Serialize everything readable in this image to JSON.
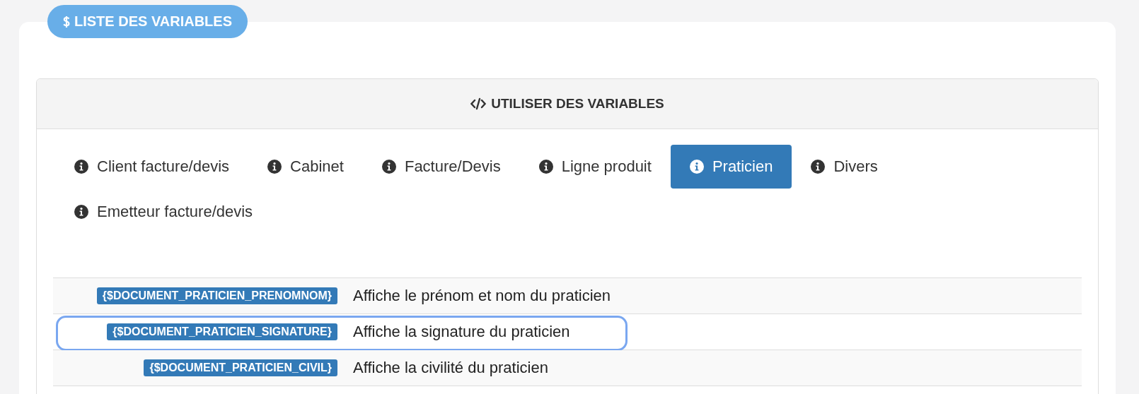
{
  "badge": {
    "label": "LISTE DES VARIABLES"
  },
  "panel": {
    "title": "UTILISER DES VARIABLES"
  },
  "tabs": [
    {
      "label": "Client facture/devis",
      "selected": false
    },
    {
      "label": "Cabinet",
      "selected": false
    },
    {
      "label": "Facture/Devis",
      "selected": false
    },
    {
      "label": "Ligne produit",
      "selected": false
    },
    {
      "label": "Praticien",
      "selected": true
    },
    {
      "label": "Divers",
      "selected": false
    },
    {
      "label": "Emetteur facture/devis",
      "selected": false
    }
  ],
  "variables": [
    {
      "code": "{$DOCUMENT_PRATICIEN_PRENOMNOM}",
      "description": "Affiche le prénom et nom du praticien",
      "focused": false
    },
    {
      "code": "{$DOCUMENT_PRATICIEN_SIGNATURE}",
      "description": "Affiche la signature du praticien",
      "focused": true
    },
    {
      "code": "{$DOCUMENT_PRATICIEN_CIVIL}",
      "description": "Affiche la civilité du praticien",
      "focused": false
    }
  ]
}
